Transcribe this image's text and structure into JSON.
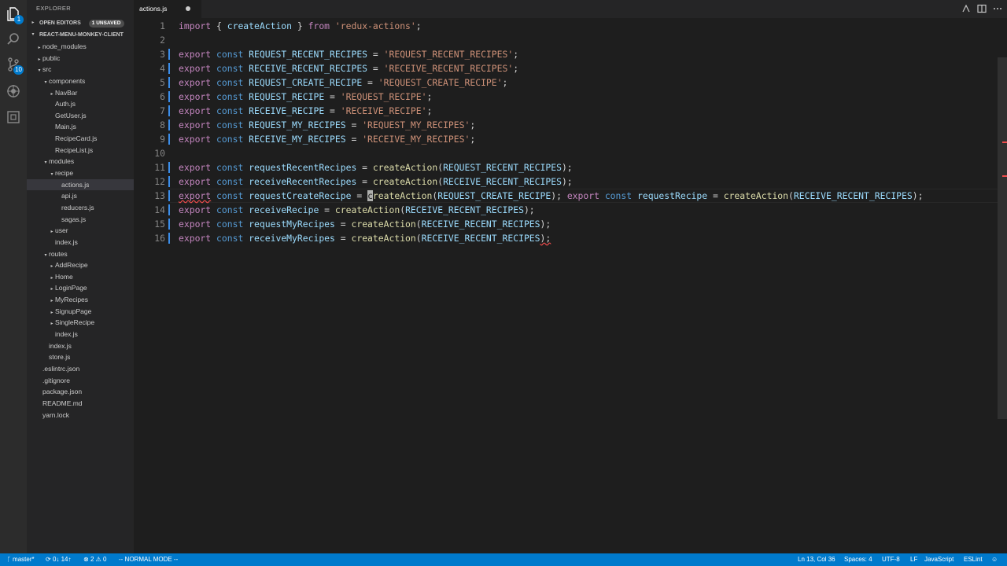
{
  "activity": {
    "explorer_badge": "1",
    "scm_badge": "10"
  },
  "sidebar": {
    "title": "EXPLORER",
    "open_editors_label": "OPEN EDITORS",
    "open_editors_badge": "1 UNSAVED",
    "project_label": "REACT-MENU-MONKEY-CLIENT",
    "tree": [
      {
        "label": "node_modules",
        "indent": 1,
        "twisty": "▸"
      },
      {
        "label": "public",
        "indent": 1,
        "twisty": "▸"
      },
      {
        "label": "src",
        "indent": 1,
        "twisty": "▾"
      },
      {
        "label": "components",
        "indent": 2,
        "twisty": "▾"
      },
      {
        "label": "NavBar",
        "indent": 3,
        "twisty": "▸"
      },
      {
        "label": "Auth.js",
        "indent": 3,
        "twisty": ""
      },
      {
        "label": "GetUser.js",
        "indent": 3,
        "twisty": ""
      },
      {
        "label": "Main.js",
        "indent": 3,
        "twisty": ""
      },
      {
        "label": "RecipeCard.js",
        "indent": 3,
        "twisty": ""
      },
      {
        "label": "RecipeList.js",
        "indent": 3,
        "twisty": ""
      },
      {
        "label": "modules",
        "indent": 2,
        "twisty": "▾"
      },
      {
        "label": "recipe",
        "indent": 3,
        "twisty": "▾"
      },
      {
        "label": "actions.js",
        "indent": 4,
        "twisty": "",
        "active": true
      },
      {
        "label": "api.js",
        "indent": 4,
        "twisty": ""
      },
      {
        "label": "reducers.js",
        "indent": 4,
        "twisty": ""
      },
      {
        "label": "sagas.js",
        "indent": 4,
        "twisty": ""
      },
      {
        "label": "user",
        "indent": 3,
        "twisty": "▸"
      },
      {
        "label": "index.js",
        "indent": 3,
        "twisty": ""
      },
      {
        "label": "routes",
        "indent": 2,
        "twisty": "▾"
      },
      {
        "label": "AddRecipe",
        "indent": 3,
        "twisty": "▸"
      },
      {
        "label": "Home",
        "indent": 3,
        "twisty": "▸"
      },
      {
        "label": "LoginPage",
        "indent": 3,
        "twisty": "▸"
      },
      {
        "label": "MyRecipes",
        "indent": 3,
        "twisty": "▸"
      },
      {
        "label": "SignupPage",
        "indent": 3,
        "twisty": "▸"
      },
      {
        "label": "SingleRecipe",
        "indent": 3,
        "twisty": "▸"
      },
      {
        "label": "index.js",
        "indent": 3,
        "twisty": ""
      },
      {
        "label": "index.js",
        "indent": 2,
        "twisty": ""
      },
      {
        "label": "store.js",
        "indent": 2,
        "twisty": ""
      },
      {
        "label": ".eslintrc.json",
        "indent": 1,
        "twisty": ""
      },
      {
        "label": ".gitignore",
        "indent": 1,
        "twisty": ""
      },
      {
        "label": "package.json",
        "indent": 1,
        "twisty": ""
      },
      {
        "label": "README.md",
        "indent": 1,
        "twisty": ""
      },
      {
        "label": "yarn.lock",
        "indent": 1,
        "twisty": ""
      }
    ]
  },
  "tabs": [
    {
      "label": "actions.js",
      "unsaved": true
    }
  ],
  "editor": {
    "lines": [
      {
        "n": "1",
        "tokens": [
          [
            "k",
            "import"
          ],
          [
            "p",
            " { "
          ],
          [
            "v",
            "createAction"
          ],
          [
            "p",
            " } "
          ],
          [
            "k",
            "from"
          ],
          [
            "p",
            " "
          ],
          [
            "s",
            "'redux-actions'"
          ],
          [
            "p",
            ";"
          ]
        ]
      },
      {
        "n": "2",
        "tokens": []
      },
      {
        "n": "3",
        "mark": true,
        "tokens": [
          [
            "k",
            "export"
          ],
          [
            "p",
            " "
          ],
          [
            "cst",
            "const"
          ],
          [
            "p",
            " "
          ],
          [
            "v",
            "REQUEST_RECENT_RECIPES"
          ],
          [
            "p",
            " = "
          ],
          [
            "s",
            "'REQUEST_RECENT_RECIPES'"
          ],
          [
            "p",
            ";"
          ]
        ]
      },
      {
        "n": "4",
        "mark": true,
        "tokens": [
          [
            "k",
            "export"
          ],
          [
            "p",
            " "
          ],
          [
            "cst",
            "const"
          ],
          [
            "p",
            " "
          ],
          [
            "v",
            "RECEIVE_RECENT_RECIPES"
          ],
          [
            "p",
            " = "
          ],
          [
            "s",
            "'RECEIVE_RECENT_RECIPES'"
          ],
          [
            "p",
            ";"
          ]
        ]
      },
      {
        "n": "5",
        "mark": true,
        "tokens": [
          [
            "k",
            "export"
          ],
          [
            "p",
            " "
          ],
          [
            "cst",
            "const"
          ],
          [
            "p",
            " "
          ],
          [
            "v",
            "REQUEST_CREATE_RECIPE"
          ],
          [
            "p",
            " = "
          ],
          [
            "s",
            "'REQUEST_CREATE_RECIPE'"
          ],
          [
            "p",
            ";"
          ]
        ]
      },
      {
        "n": "6",
        "mark": true,
        "tokens": [
          [
            "k",
            "export"
          ],
          [
            "p",
            " "
          ],
          [
            "cst",
            "const"
          ],
          [
            "p",
            " "
          ],
          [
            "v",
            "REQUEST_RECIPE"
          ],
          [
            "p",
            " = "
          ],
          [
            "s",
            "'REQUEST_RECIPE'"
          ],
          [
            "p",
            ";"
          ]
        ]
      },
      {
        "n": "7",
        "mark": true,
        "tokens": [
          [
            "k",
            "export"
          ],
          [
            "p",
            " "
          ],
          [
            "cst",
            "const"
          ],
          [
            "p",
            " "
          ],
          [
            "v",
            "RECEIVE_RECIPE"
          ],
          [
            "p",
            " = "
          ],
          [
            "s",
            "'RECEIVE_RECIPE'"
          ],
          [
            "p",
            ";"
          ]
        ]
      },
      {
        "n": "8",
        "mark": true,
        "tokens": [
          [
            "k",
            "export"
          ],
          [
            "p",
            " "
          ],
          [
            "cst",
            "const"
          ],
          [
            "p",
            " "
          ],
          [
            "v",
            "REQUEST_MY_RECIPES"
          ],
          [
            "p",
            " = "
          ],
          [
            "s",
            "'REQUEST_MY_RECIPES'"
          ],
          [
            "p",
            ";"
          ]
        ]
      },
      {
        "n": "9",
        "mark": true,
        "tokens": [
          [
            "k",
            "export"
          ],
          [
            "p",
            " "
          ],
          [
            "cst",
            "const"
          ],
          [
            "p",
            " "
          ],
          [
            "v",
            "RECEIVE_MY_RECIPES"
          ],
          [
            "p",
            " = "
          ],
          [
            "s",
            "'RECEIVE_MY_RECIPES'"
          ],
          [
            "p",
            ";"
          ]
        ]
      },
      {
        "n": "10",
        "tokens": []
      },
      {
        "n": "11",
        "mark": true,
        "tokens": [
          [
            "k",
            "export"
          ],
          [
            "p",
            " "
          ],
          [
            "cst",
            "const"
          ],
          [
            "p",
            " "
          ],
          [
            "v",
            "requestRecentRecipes"
          ],
          [
            "p",
            " = "
          ],
          [
            "f",
            "createAction"
          ],
          [
            "p",
            "("
          ],
          [
            "v",
            "REQUEST_RECENT_RECIPES"
          ],
          [
            "p",
            ");"
          ]
        ]
      },
      {
        "n": "12",
        "mark": true,
        "tokens": [
          [
            "k",
            "export"
          ],
          [
            "p",
            " "
          ],
          [
            "cst",
            "const"
          ],
          [
            "p",
            " "
          ],
          [
            "v",
            "receiveRecentRecipes"
          ],
          [
            "p",
            " = "
          ],
          [
            "f",
            "createAction"
          ],
          [
            "p",
            "("
          ],
          [
            "v",
            "RECEIVE_RECENT_RECIPES"
          ],
          [
            "p",
            ");"
          ]
        ]
      },
      {
        "n": "13",
        "mark": true,
        "current": true,
        "tokens": [
          [
            "kerr",
            "export"
          ],
          [
            "p",
            " "
          ],
          [
            "cst",
            "const"
          ],
          [
            "p",
            " "
          ],
          [
            "v",
            "requestCreateRecipe"
          ],
          [
            "p",
            " = "
          ],
          [
            "cursor",
            "c"
          ],
          [
            "f",
            "reateAction"
          ],
          [
            "p",
            "("
          ],
          [
            "v",
            "REQUEST_CREATE_RECIPE"
          ],
          [
            "p",
            ");"
          ],
          [
            "p",
            " "
          ],
          [
            "k",
            "export"
          ],
          [
            "p",
            " "
          ],
          [
            "cst",
            "const"
          ],
          [
            "p",
            " "
          ],
          [
            "v",
            "requestRecipe"
          ],
          [
            "p",
            " = "
          ],
          [
            "f",
            "createAction"
          ],
          [
            "p",
            "("
          ],
          [
            "v",
            "RECEIVE_RECENT_RECIPES"
          ],
          [
            "p",
            ");"
          ]
        ]
      },
      {
        "n": "14",
        "mark": true,
        "tokens": [
          [
            "k",
            "export"
          ],
          [
            "p",
            " "
          ],
          [
            "cst",
            "const"
          ],
          [
            "p",
            " "
          ],
          [
            "v",
            "receiveRecipe"
          ],
          [
            "p",
            " = "
          ],
          [
            "f",
            "createAction"
          ],
          [
            "p",
            "("
          ],
          [
            "v",
            "RECEIVE_RECENT_RECIPES"
          ],
          [
            "p",
            ");"
          ]
        ]
      },
      {
        "n": "15",
        "mark": true,
        "tokens": [
          [
            "k",
            "export"
          ],
          [
            "p",
            " "
          ],
          [
            "cst",
            "const"
          ],
          [
            "p",
            " "
          ],
          [
            "v",
            "requestMyRecipes"
          ],
          [
            "p",
            " = "
          ],
          [
            "f",
            "createAction"
          ],
          [
            "p",
            "("
          ],
          [
            "v",
            "RECEIVE_RECENT_RECIPES"
          ],
          [
            "p",
            ");"
          ]
        ]
      },
      {
        "n": "16",
        "mark": true,
        "tokens": [
          [
            "k",
            "export"
          ],
          [
            "p",
            " "
          ],
          [
            "cst",
            "const"
          ],
          [
            "p",
            " "
          ],
          [
            "v",
            "receiveMyRecipes"
          ],
          [
            "p",
            " = "
          ],
          [
            "f",
            "createAction"
          ],
          [
            "p",
            "("
          ],
          [
            "v",
            "RECEIVE_RECENT_RECIPES"
          ],
          [
            "perr",
            ");"
          ]
        ]
      }
    ]
  },
  "status": {
    "branch": "master*",
    "sync": "0↓ 14↑",
    "problems_errors": "2",
    "problems_warnings": "0",
    "vim_mode": "-- NORMAL MODE --",
    "cursor_pos": "Ln 13, Col 36",
    "indent": "Spaces: 4",
    "encoding": "UTF-8",
    "eol": "LF",
    "language": "JavaScript",
    "linter": "ESLint"
  },
  "colors": {
    "accent": "#007acc",
    "keyword": "#c586c0",
    "string": "#ce9178",
    "variable": "#9cdcfe",
    "function": "#dcdcaa",
    "storage": "#569cd6"
  }
}
